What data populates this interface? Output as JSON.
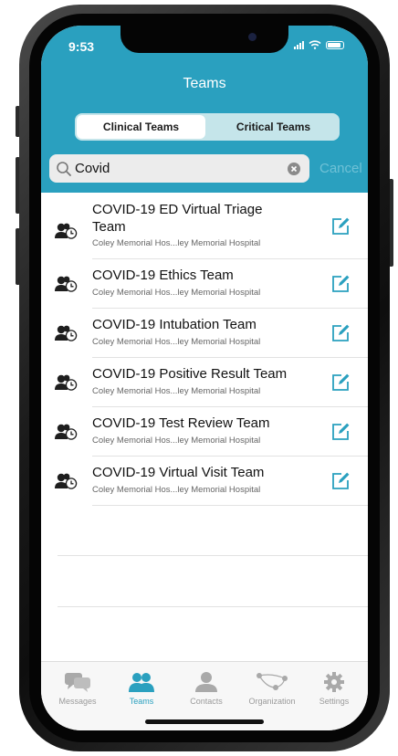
{
  "status": {
    "time": "9:53"
  },
  "nav": {
    "title": "Teams"
  },
  "segments": [
    {
      "label": "Clinical Teams",
      "active": true
    },
    {
      "label": "Critical Teams",
      "active": false
    }
  ],
  "search": {
    "value": "Covid",
    "cancel_label": "Cancel"
  },
  "teams": [
    {
      "name": "COVID-19 ED Virtual Triage Team",
      "org": "Coley Memorial Hos...ley Memorial Hospital"
    },
    {
      "name": "COVID-19 Ethics Team",
      "org": "Coley Memorial Hos...ley Memorial Hospital"
    },
    {
      "name": "COVID-19 Intubation Team",
      "org": "Coley Memorial Hos...ley Memorial Hospital"
    },
    {
      "name": "COVID-19 Positive Result Team",
      "org": "Coley Memorial Hos...ley Memorial Hospital"
    },
    {
      "name": "COVID-19 Test Review Team",
      "org": "Coley Memorial Hos...ley Memorial Hospital"
    },
    {
      "name": "COVID-19 Virtual Visit Team",
      "org": "Coley Memorial Hos...ley Memorial Hospital"
    }
  ],
  "tabs": [
    {
      "label": "Messages",
      "icon": "chat-bubbles-icon",
      "active": false
    },
    {
      "label": "Teams",
      "icon": "team-icon",
      "active": true
    },
    {
      "label": "Contacts",
      "icon": "person-icon",
      "active": false
    },
    {
      "label": "Organization",
      "icon": "network-icon",
      "active": false
    },
    {
      "label": "Settings",
      "icon": "gear-icon",
      "active": false
    }
  ],
  "colors": {
    "header": "#2aa0bf",
    "accent": "#2aa0bf",
    "segment_track": "#c5e5ea",
    "cancel": "#6fc1d6"
  }
}
